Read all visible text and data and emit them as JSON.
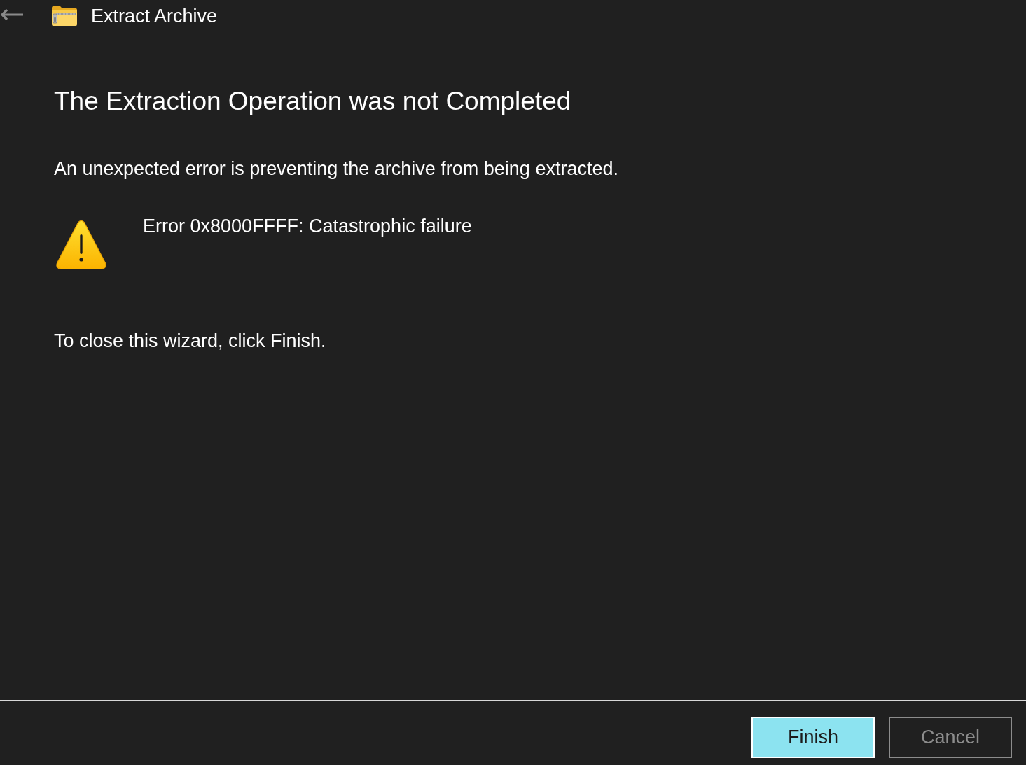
{
  "window": {
    "title": "Extract Archive",
    "back_button": {
      "disabled": true
    }
  },
  "heading": "The Extraction Operation was not Completed",
  "message": "An unexpected error is preventing the archive from being extracted.",
  "error": {
    "text": "Error 0x8000FFFF: Catastrophic failure"
  },
  "instruction": "To close this wizard, click Finish.",
  "buttons": [
    {
      "label": "Finish",
      "default": true,
      "disabled": false
    },
    {
      "label": "Cancel",
      "default": false,
      "disabled": true
    }
  ]
}
